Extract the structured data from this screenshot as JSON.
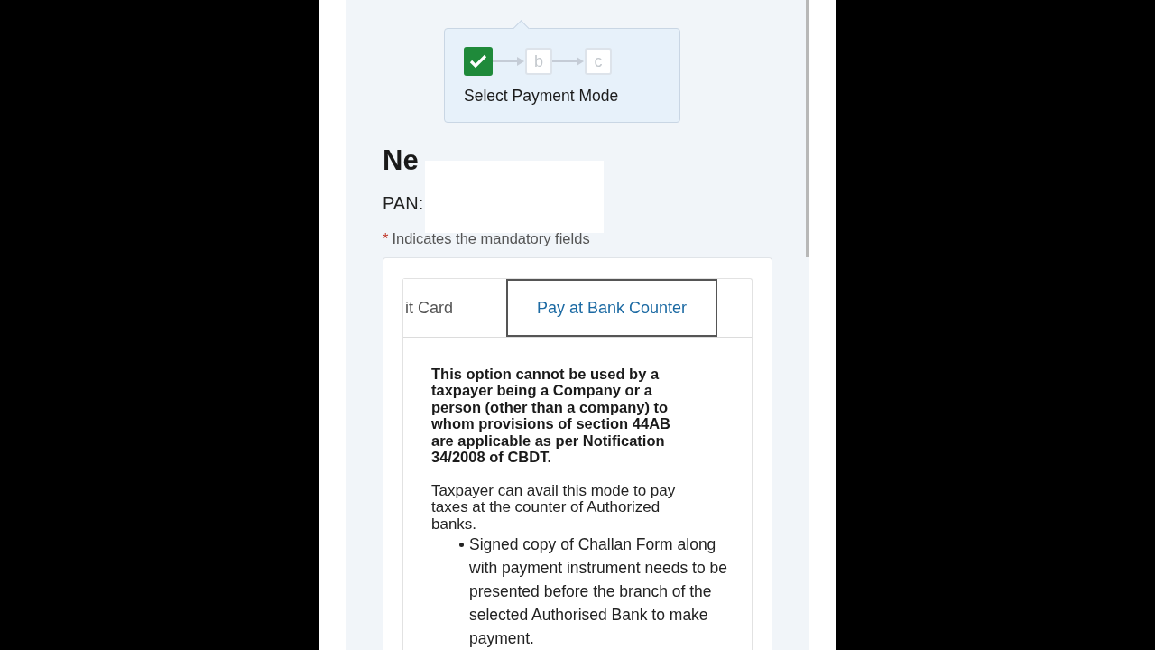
{
  "stepper": {
    "steps": [
      {
        "kind": "done"
      },
      {
        "kind": "pending",
        "label": "b"
      },
      {
        "kind": "pending",
        "label": "c"
      }
    ],
    "title": "Select Payment Mode"
  },
  "heading": "Ne",
  "pan": {
    "label": "PAN:"
  },
  "mandatory_note": {
    "mark": "*",
    "text": "Indicates the mandatory fields"
  },
  "tabs": [
    {
      "label": "it Card",
      "selected": false
    },
    {
      "label": "Pay at Bank Counter",
      "selected": true
    }
  ],
  "notice": "This option cannot be used by a taxpayer being a Company or a person (other than a company) to whom provisions of section 44AB are applicable as per Notification 34/2008 of CBDT.",
  "description": "Taxpayer can avail this mode to pay taxes at the counter of Authorized banks.",
  "bullets": [
    "Signed copy of Challan Form along with payment instrument needs to be presented before the branch of the selected Authorised Bank to make payment."
  ]
}
